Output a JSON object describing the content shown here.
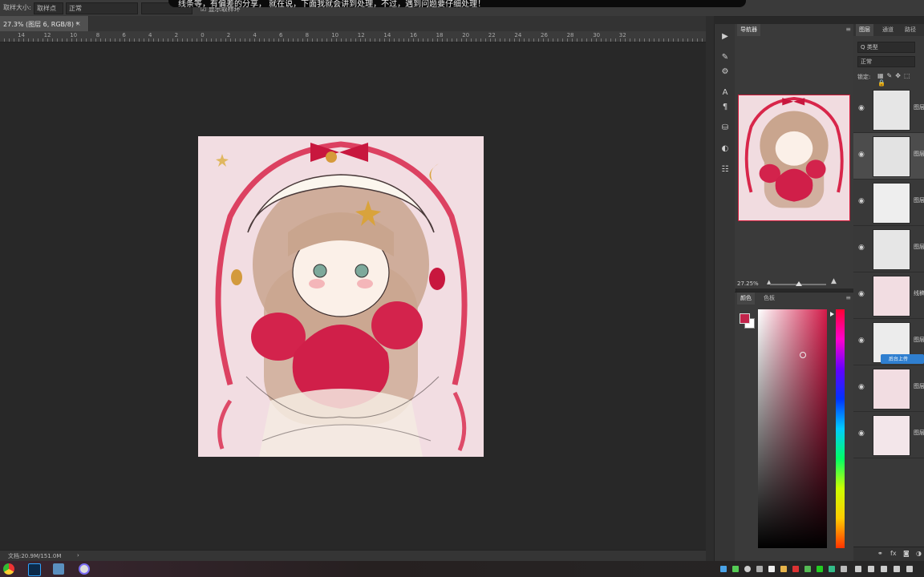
{
  "subtitle": "线条等，有偏差的分享，    就在说，下面我就会讲到处理，不过，遇到问题要仔细处理！",
  "options_bar": {
    "sample_size_label": "取样大小:",
    "sample_size_value": "取样点",
    "mode_value": "正常",
    "extra_label": "显示取样环"
  },
  "document_tab": {
    "title": "27.3% (图层 6, RGB/8) *",
    "close": "×"
  },
  "ruler_ticks": [
    "14",
    "12",
    "10",
    "8",
    "6",
    "4",
    "2",
    "0",
    "2",
    "4",
    "6",
    "8",
    "10",
    "12",
    "14",
    "16",
    "18",
    "20",
    "22",
    "24",
    "26",
    "28",
    "30",
    "32"
  ],
  "status_bar": {
    "doc_size": "文档:20.9M/151.0M",
    "arrow": "›"
  },
  "navigator": {
    "tab_label": "导航器",
    "zoom_value": "27.25%"
  },
  "color_panel": {
    "tabs": [
      "颜色",
      "色板"
    ],
    "foreground": "#c2244b",
    "background": "#ffffff"
  },
  "layers_panel": {
    "tabs": [
      "图层",
      "通道",
      "路径"
    ],
    "filter_label": "Q 类型",
    "blend_mode": "正常",
    "lock_label": "锁定:",
    "layers": [
      {
        "name": "图层",
        "thumb": "#e6e6e6"
      },
      {
        "name": "图层",
        "thumb": "#e3e3e3"
      },
      {
        "name": "图层",
        "thumb": "#eeeeee"
      },
      {
        "name": "图层",
        "thumb": "#e6e6e6"
      },
      {
        "name": "线稿",
        "thumb": "#f2dde2"
      },
      {
        "name": "图层",
        "thumb": "#ececec"
      },
      {
        "name": "图层",
        "thumb": "#f2dde2"
      },
      {
        "name": "图层",
        "thumb": "#f3e6ea"
      }
    ],
    "upload_badge": "后台上传"
  },
  "accent_colors": {
    "panel_bg": "#3a3a3a",
    "canvas_bg": "#282828",
    "selection_border": "#d21b3a"
  }
}
